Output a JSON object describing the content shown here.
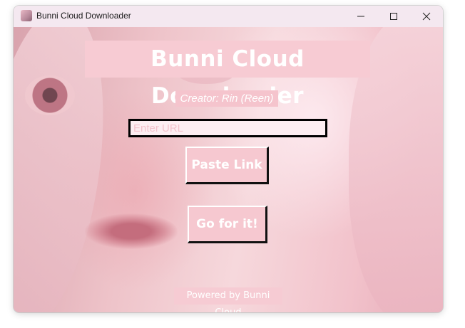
{
  "window": {
    "title": "Bunni Cloud Downloader",
    "icon": "app-avatar-icon",
    "controls": [
      "minimize-icon",
      "maximize-icon",
      "close-icon"
    ]
  },
  "main": {
    "title": "Bunni Cloud Downloader",
    "creator": "Creator: Rin (Reen)",
    "url_input": {
      "placeholder": "Enter URL",
      "value": ""
    },
    "paste_button": "Paste Link",
    "go_button": "Go for it!",
    "footer": "Powered by Bunni Cloud"
  },
  "colors": {
    "accent": "#f6c8d0",
    "text": "#ffffff",
    "input_border": "#000000"
  }
}
